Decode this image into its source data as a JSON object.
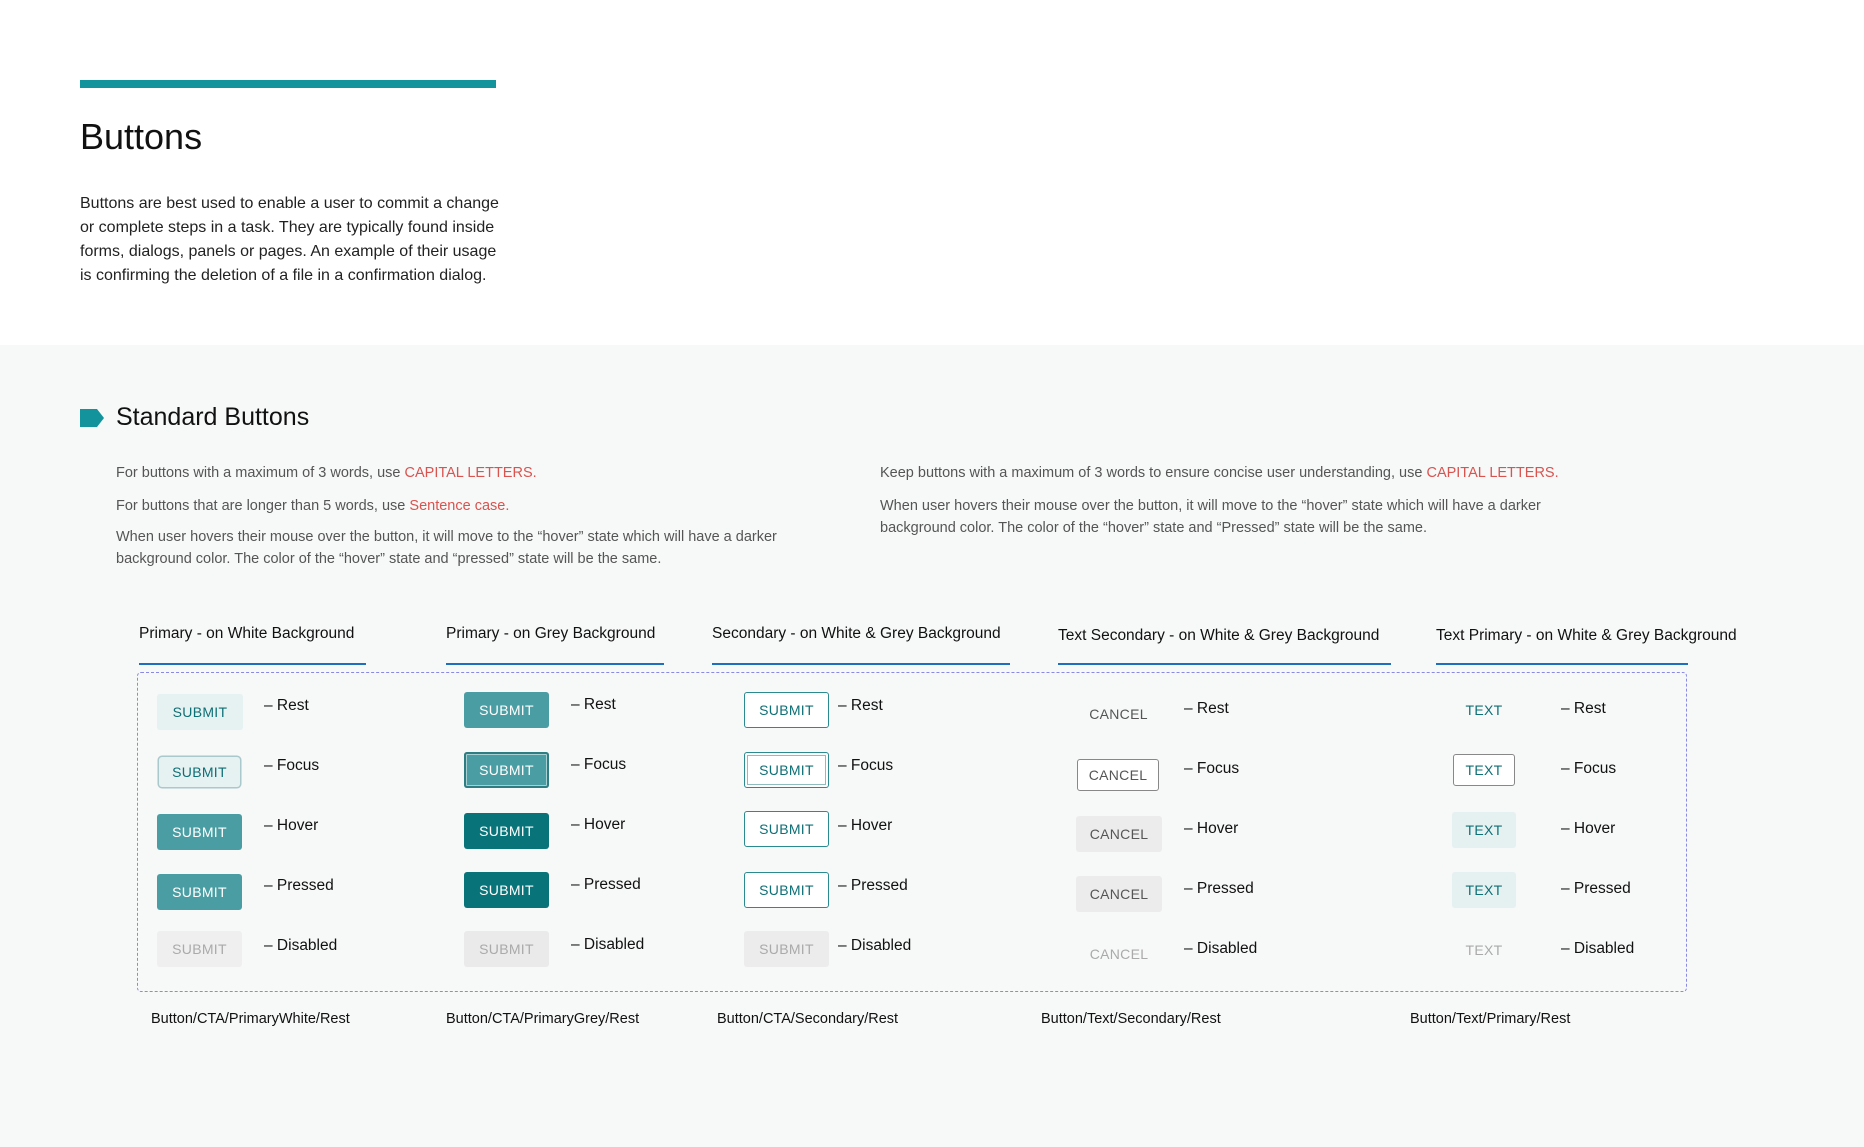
{
  "header": {
    "title": "Buttons",
    "intro": "Buttons are best used to enable a user to commit a change or complete steps in a task. They are typically found inside forms, dialogs, panels or pages. An example of their usage is confirming the deletion of a file in a confirmation dialog."
  },
  "section": {
    "title": "Standard Buttons",
    "left": {
      "p1_pre": "For buttons with a maximum of 3 words, use ",
      "p1_hl": "CAPITAL LETTERS.",
      "p2_pre": "For buttons that are longer than 5 words, use ",
      "p2_hl": "Sentence case.",
      "p3": "When user hovers their mouse over the button, it will move to the “hover” state which will have a darker background color. The color of the “hover” state and “pressed” state will be the same."
    },
    "right": {
      "p1_pre": "Keep buttons with a maximum of 3 words to ensure concise user understanding, use ",
      "p1_hl": "CAPITAL LETTERS.",
      "p2": "When user hovers their mouse over the button, it will move to the “hover” state which will have a darker background color. The color of the “hover” state and “Pressed” state will be the same."
    }
  },
  "columns": [
    {
      "heading": "Primary - on White Background",
      "button_label": "SUBMIT",
      "states": [
        "– Rest",
        "– Focus",
        "– Hover",
        "– Pressed",
        "– Disabled"
      ],
      "component": "Button/CTA/PrimaryWhite/Rest"
    },
    {
      "heading": "Primary - on Grey Background",
      "button_label": "SUBMIT",
      "states": [
        "– Rest",
        "– Focus",
        "– Hover",
        "– Pressed",
        "– Disabled"
      ],
      "component": "Button/CTA/PrimaryGrey/Rest"
    },
    {
      "heading": "Secondary - on White & Grey Background",
      "button_label": "SUBMIT",
      "states": [
        "– Rest",
        "– Focus",
        "– Hover",
        "– Pressed",
        "– Disabled"
      ],
      "component": "Button/CTA/Secondary/Rest"
    },
    {
      "heading": "Text Secondary - on White & Grey Background",
      "button_label": "CANCEL",
      "states": [
        "– Rest",
        "– Focus",
        "– Hover",
        "– Pressed",
        "– Disabled"
      ],
      "component": "Button/Text/Secondary/Rest"
    },
    {
      "heading": "Text Primary - on White & Grey Background",
      "button_label": "TEXT",
      "states": [
        "– Rest",
        "– Focus",
        "– Hover",
        "– Pressed",
        "– Disabled"
      ],
      "component": "Button/Text/Primary/Rest"
    }
  ],
  "colors": {
    "accent": "#13949c",
    "highlight": "#d9534f",
    "heading_underline": "#1f6fbf",
    "primary_hover": "#087479",
    "primary_rest": "#4a9ea3"
  }
}
